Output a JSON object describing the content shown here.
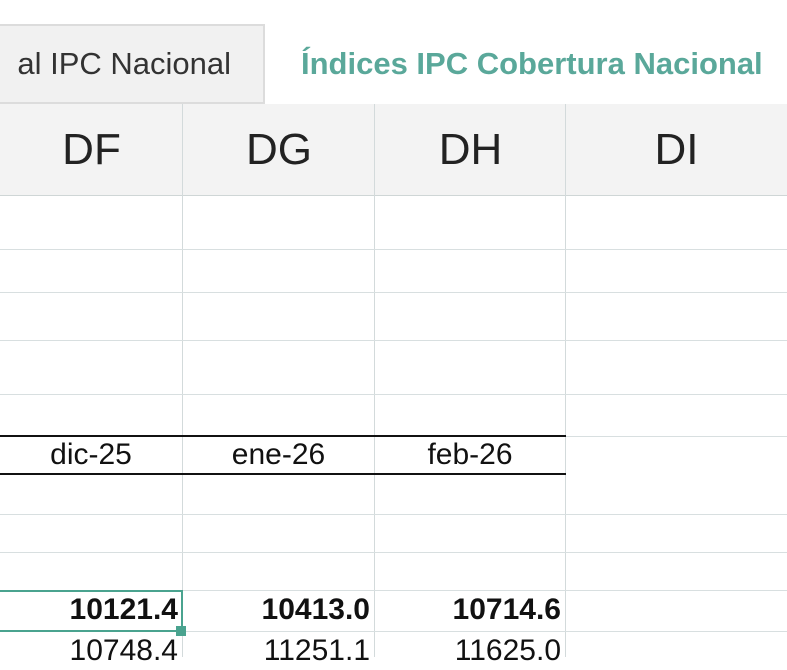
{
  "sheet_tabs": [
    {
      "label": "al IPC Nacional",
      "active": false
    },
    {
      "label": "Índices IPC Cobertura Nacional",
      "active": true
    }
  ],
  "columns": [
    "DF",
    "DG",
    "DH",
    "DI"
  ],
  "date_row": [
    "dic-25",
    "ene-26",
    "feb-26"
  ],
  "values_row_1": [
    "10121.4",
    "10413.0",
    "10714.6"
  ],
  "values_row_2": [
    "10748.4",
    "11251.1",
    "11625.0"
  ],
  "colors": {
    "active_tab": "#5aa89a",
    "selection": "#4aa38f"
  }
}
